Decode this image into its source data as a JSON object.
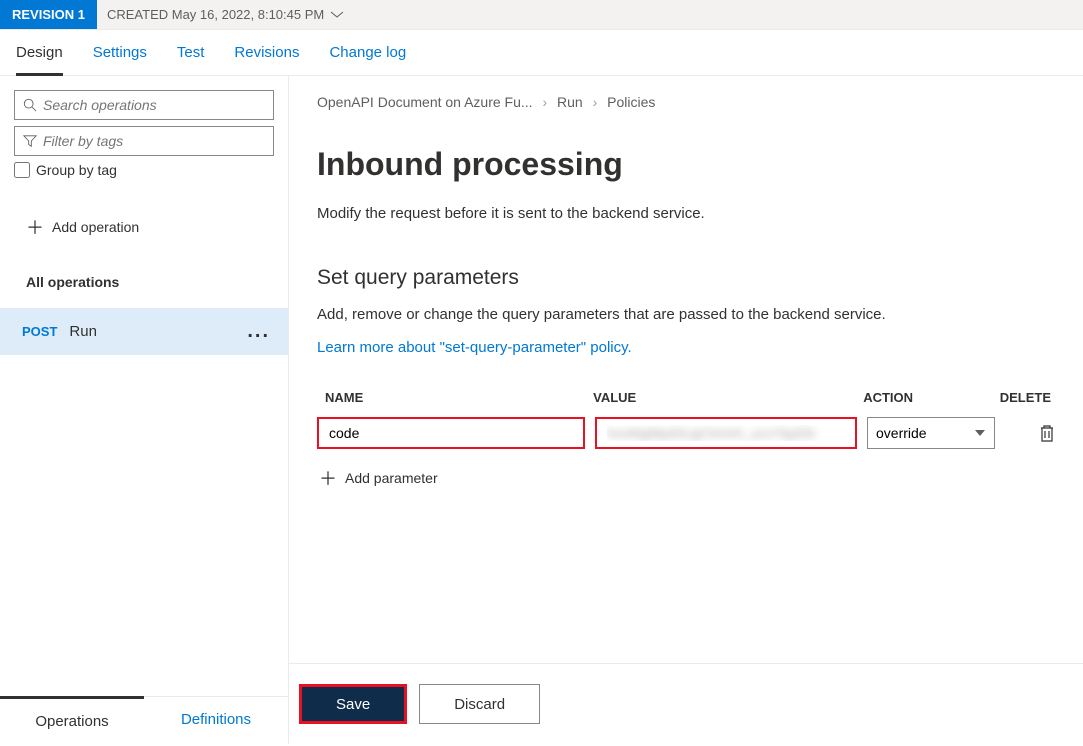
{
  "topbar": {
    "revision_label": "REVISION 1",
    "created_label": "CREATED May 16, 2022, 8:10:45 PM"
  },
  "tabs": {
    "design": "Design",
    "settings": "Settings",
    "test": "Test",
    "revisions": "Revisions",
    "changelog": "Change log"
  },
  "sidebar": {
    "search_placeholder": "Search operations",
    "filter_placeholder": "Filter by tags",
    "group_by_label": "Group by tag",
    "add_operation": "Add operation",
    "all_operations": "All operations",
    "operation": {
      "method": "POST",
      "name": "Run"
    },
    "bottom_tabs": {
      "operations": "Operations",
      "definitions": "Definitions"
    }
  },
  "breadcrumb": {
    "a": "OpenAPI Document on Azure Fu...",
    "b": "Run",
    "c": "Policies"
  },
  "page": {
    "title": "Inbound processing",
    "desc": "Modify the request before it is sent to the backend service."
  },
  "section": {
    "title": "Set query parameters",
    "desc": "Add, remove or change the query parameters that are passed to the backend service.",
    "learn": "Learn more about \"set-query-parameter\" policy."
  },
  "table": {
    "headers": {
      "name": "NAME",
      "value": "VALUE",
      "action": "ACTION",
      "delete": "DELETE"
    },
    "row": {
      "name": "code",
      "value": "hxxMgMpdScgCtmnH_ucvYlpjSfz",
      "action": "override"
    },
    "add_parameter": "Add parameter"
  },
  "footer": {
    "save": "Save",
    "discard": "Discard"
  }
}
